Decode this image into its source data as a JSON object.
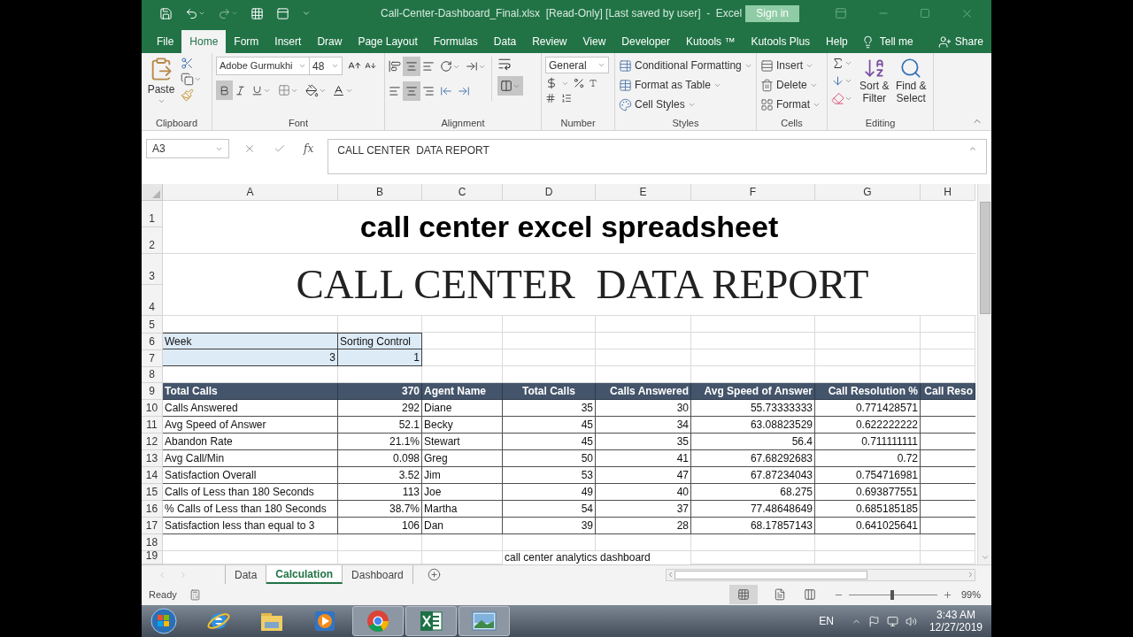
{
  "title_bar": {
    "title": "Call-Center-Dashboard_Final.xlsx  [Read-Only] [Last saved by user]  -  Excel",
    "sign_in": "Sign in"
  },
  "ribbon_tabs": [
    {
      "label": "File",
      "selected": false
    },
    {
      "label": "Home",
      "selected": true
    },
    {
      "label": "Form",
      "selected": false
    },
    {
      "label": "Insert",
      "selected": false
    },
    {
      "label": "Draw",
      "selected": false
    },
    {
      "label": "Page Layout",
      "selected": false
    },
    {
      "label": "Formulas",
      "selected": false
    },
    {
      "label": "Data",
      "selected": false
    },
    {
      "label": "Review",
      "selected": false
    },
    {
      "label": "View",
      "selected": false
    },
    {
      "label": "Developer",
      "selected": false
    },
    {
      "label": "Kutools ™",
      "selected": false
    },
    {
      "label": "Kutools Plus",
      "selected": false
    },
    {
      "label": "Help",
      "selected": false
    }
  ],
  "tell_me": "Tell me",
  "share": "Share",
  "ribbon": {
    "clipboard": {
      "paste": "Paste",
      "label": "Clipboard"
    },
    "font": {
      "name": "Adobe Gurmukhi",
      "size": "48",
      "bold": true,
      "label": "Font"
    },
    "alignment": {
      "middle": true,
      "center": true,
      "merge": true,
      "label": "Alignment"
    },
    "number": {
      "format": "General",
      "label": "Number"
    },
    "styles": {
      "items": [
        "Conditional Formatting",
        "Format as Table",
        "Cell Styles"
      ],
      "label": "Styles"
    },
    "cells": {
      "items": [
        "Insert",
        "Delete",
        "Format"
      ],
      "label": "Cells"
    },
    "editing": {
      "sort": "Sort & Filter",
      "find": "Find & Select",
      "label": "Editing"
    }
  },
  "formula_bar": {
    "name_box": "A3",
    "fx": "fx",
    "formula": "CALL CENTER  DATA REPORT"
  },
  "sheet": {
    "columns": [
      "A",
      "B",
      "C",
      "D",
      "E",
      "F",
      "G",
      "H"
    ],
    "row_numbers": [
      "1",
      "2",
      "3",
      "4",
      "5",
      "6",
      "7",
      "8",
      "9",
      "10",
      "11",
      "12",
      "13",
      "14",
      "15",
      "16",
      "17",
      "18",
      "19"
    ],
    "title": "call center excel spreadsheet",
    "report_title": "CALL CENTER  DATA REPORT",
    "week_table": {
      "headers": [
        "Week",
        "Sorting Control"
      ],
      "values": [
        "3",
        "1"
      ]
    },
    "summary": [
      {
        "label": "Total Calls",
        "value": "370"
      },
      {
        "label": "Calls Answered",
        "value": "292"
      },
      {
        "label": "Avg Speed of Answer",
        "value": "52.1"
      },
      {
        "label": "Abandon Rate",
        "value": "21.1%"
      },
      {
        "label": "Avg Call/Min",
        "value": "0.098"
      },
      {
        "label": "Satisfaction Overall",
        "value": "3.52"
      },
      {
        "label": "Calls of Less than 180 Seconds",
        "value": "113"
      },
      {
        "label": "% Calls of Less than 180 Seconds",
        "value": "38.7%"
      },
      {
        "label": "Satisfaction less than equal to 3",
        "value": "106"
      }
    ],
    "agents_table": {
      "columns": [
        "Agent Name",
        "Total Calls",
        "Calls Answered",
        "Avg Speed of Answer",
        "Call Resolution %",
        "Call Reso"
      ],
      "rows": [
        [
          "Diane",
          "35",
          "30",
          "55.73333333",
          "0.771428571"
        ],
        [
          "Becky",
          "45",
          "34",
          "63.08823529",
          "0.622222222"
        ],
        [
          "Stewart",
          "45",
          "35",
          "56.4",
          "0.711111111"
        ],
        [
          "Greg",
          "50",
          "41",
          "67.68292683",
          "0.72"
        ],
        [
          "Jim",
          "53",
          "47",
          "67.87234043",
          "0.754716981"
        ],
        [
          "Joe",
          "49",
          "40",
          "68.275",
          "0.693877551"
        ],
        [
          "Martha",
          "54",
          "37",
          "77.48648649",
          "0.685185185"
        ],
        [
          "Dan",
          "39",
          "28",
          "68.17857143",
          "0.641025641"
        ]
      ]
    },
    "note": "call center analytics dashboard"
  },
  "sheet_tabs": [
    {
      "label": "Data",
      "selected": false
    },
    {
      "label": "Calculation",
      "selected": true
    },
    {
      "label": "Dashboard",
      "selected": false
    }
  ],
  "status_bar": {
    "status": "Ready",
    "zoom": "99%",
    "zoom_slider": {
      "level": 0.49
    }
  },
  "taskbar": {
    "apps": [
      {
        "kind": "ie",
        "active": false
      },
      {
        "kind": "folder",
        "active": false
      },
      {
        "kind": "media",
        "active": false
      },
      {
        "kind": "chrome",
        "active": true
      },
      {
        "kind": "excel",
        "active": true
      },
      {
        "kind": "photos",
        "active": true
      }
    ],
    "language": "EN",
    "time": "3:43 AM",
    "date": "12/27/2019"
  }
}
